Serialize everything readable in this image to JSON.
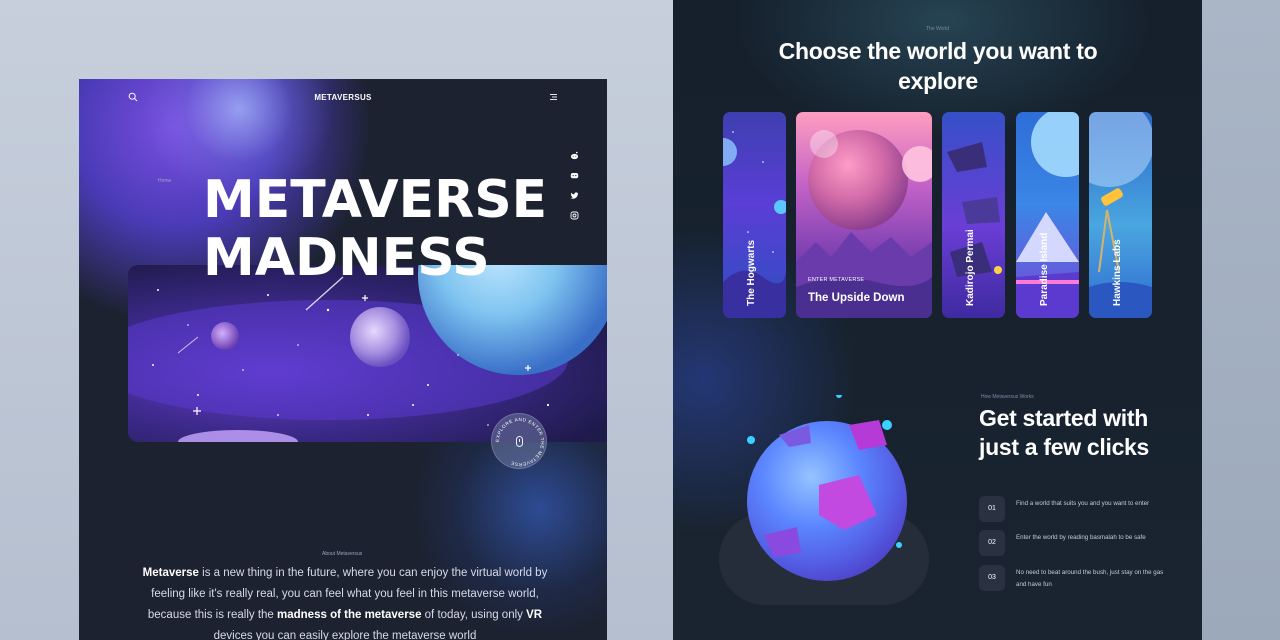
{
  "left_page": {
    "brand": "METAVERSUS",
    "breadcrumb": "Home",
    "hero": {
      "line1": "METAVERSE",
      "line2": "MADNESS"
    },
    "explore_badge": "EXPLORE AND ENTER THE METAVERSE",
    "about": {
      "breadcrumb": "About Metaversus",
      "p1_bold": "Metaverse",
      "p1_rest": " is a new thing in the future, where you can enjoy the virtual world by feeling like it's really real, you can feel what you feel in this metaverse world, because this is really the ",
      "p2_bold": "madness of the metaverse",
      "p2_rest": " of today, using only ",
      "p3_bold": "VR",
      "p3_rest": " devices you can easily explore the metaverse world"
    },
    "social_icons": [
      "reddit-icon",
      "discord-icon",
      "twitter-icon",
      "instagram-icon"
    ]
  },
  "right_page": {
    "breadcrumb": "The World",
    "title": "Choose the world you want to explore",
    "cards": [
      {
        "label": "The Hogwarts"
      },
      {
        "label": "The Upside Down",
        "tag": "ENTER METAVERSE"
      },
      {
        "label": "Kadirojo Permai"
      },
      {
        "label": "Paradise Island"
      },
      {
        "label": "Hawkins Labs"
      }
    ],
    "how": {
      "breadcrumb": "How Metaversus Works",
      "title": "Get started with just a few clicks",
      "steps": [
        {
          "num": "01",
          "text": "Find a world that suits you and you want to enter"
        },
        {
          "num": "02",
          "text": "Enter the world by reading basmalah to be safe"
        },
        {
          "num": "03",
          "text": "No need to beat around the bush, just stay on the gas and have fun"
        }
      ]
    }
  },
  "colors": {
    "dark_bg": "#1c2230",
    "accent_purple": "#6a3fd0",
    "accent_blue": "#5b86ff"
  }
}
